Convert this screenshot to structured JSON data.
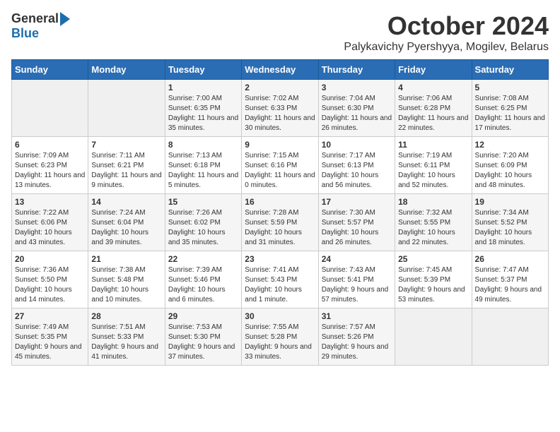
{
  "logo": {
    "general": "General",
    "blue": "Blue"
  },
  "title": {
    "month": "October 2024",
    "location": "Palykavichy Pyershyya, Mogilev, Belarus"
  },
  "headers": [
    "Sunday",
    "Monday",
    "Tuesday",
    "Wednesday",
    "Thursday",
    "Friday",
    "Saturday"
  ],
  "weeks": [
    [
      {
        "day": "",
        "sunrise": "",
        "sunset": "",
        "daylight": ""
      },
      {
        "day": "",
        "sunrise": "",
        "sunset": "",
        "daylight": ""
      },
      {
        "day": "1",
        "sunrise": "Sunrise: 7:00 AM",
        "sunset": "Sunset: 6:35 PM",
        "daylight": "Daylight: 11 hours and 35 minutes."
      },
      {
        "day": "2",
        "sunrise": "Sunrise: 7:02 AM",
        "sunset": "Sunset: 6:33 PM",
        "daylight": "Daylight: 11 hours and 30 minutes."
      },
      {
        "day": "3",
        "sunrise": "Sunrise: 7:04 AM",
        "sunset": "Sunset: 6:30 PM",
        "daylight": "Daylight: 11 hours and 26 minutes."
      },
      {
        "day": "4",
        "sunrise": "Sunrise: 7:06 AM",
        "sunset": "Sunset: 6:28 PM",
        "daylight": "Daylight: 11 hours and 22 minutes."
      },
      {
        "day": "5",
        "sunrise": "Sunrise: 7:08 AM",
        "sunset": "Sunset: 6:25 PM",
        "daylight": "Daylight: 11 hours and 17 minutes."
      }
    ],
    [
      {
        "day": "6",
        "sunrise": "Sunrise: 7:09 AM",
        "sunset": "Sunset: 6:23 PM",
        "daylight": "Daylight: 11 hours and 13 minutes."
      },
      {
        "day": "7",
        "sunrise": "Sunrise: 7:11 AM",
        "sunset": "Sunset: 6:21 PM",
        "daylight": "Daylight: 11 hours and 9 minutes."
      },
      {
        "day": "8",
        "sunrise": "Sunrise: 7:13 AM",
        "sunset": "Sunset: 6:18 PM",
        "daylight": "Daylight: 11 hours and 5 minutes."
      },
      {
        "day": "9",
        "sunrise": "Sunrise: 7:15 AM",
        "sunset": "Sunset: 6:16 PM",
        "daylight": "Daylight: 11 hours and 0 minutes."
      },
      {
        "day": "10",
        "sunrise": "Sunrise: 7:17 AM",
        "sunset": "Sunset: 6:13 PM",
        "daylight": "Daylight: 10 hours and 56 minutes."
      },
      {
        "day": "11",
        "sunrise": "Sunrise: 7:19 AM",
        "sunset": "Sunset: 6:11 PM",
        "daylight": "Daylight: 10 hours and 52 minutes."
      },
      {
        "day": "12",
        "sunrise": "Sunrise: 7:20 AM",
        "sunset": "Sunset: 6:09 PM",
        "daylight": "Daylight: 10 hours and 48 minutes."
      }
    ],
    [
      {
        "day": "13",
        "sunrise": "Sunrise: 7:22 AM",
        "sunset": "Sunset: 6:06 PM",
        "daylight": "Daylight: 10 hours and 43 minutes."
      },
      {
        "day": "14",
        "sunrise": "Sunrise: 7:24 AM",
        "sunset": "Sunset: 6:04 PM",
        "daylight": "Daylight: 10 hours and 39 minutes."
      },
      {
        "day": "15",
        "sunrise": "Sunrise: 7:26 AM",
        "sunset": "Sunset: 6:02 PM",
        "daylight": "Daylight: 10 hours and 35 minutes."
      },
      {
        "day": "16",
        "sunrise": "Sunrise: 7:28 AM",
        "sunset": "Sunset: 5:59 PM",
        "daylight": "Daylight: 10 hours and 31 minutes."
      },
      {
        "day": "17",
        "sunrise": "Sunrise: 7:30 AM",
        "sunset": "Sunset: 5:57 PM",
        "daylight": "Daylight: 10 hours and 26 minutes."
      },
      {
        "day": "18",
        "sunrise": "Sunrise: 7:32 AM",
        "sunset": "Sunset: 5:55 PM",
        "daylight": "Daylight: 10 hours and 22 minutes."
      },
      {
        "day": "19",
        "sunrise": "Sunrise: 7:34 AM",
        "sunset": "Sunset: 5:52 PM",
        "daylight": "Daylight: 10 hours and 18 minutes."
      }
    ],
    [
      {
        "day": "20",
        "sunrise": "Sunrise: 7:36 AM",
        "sunset": "Sunset: 5:50 PM",
        "daylight": "Daylight: 10 hours and 14 minutes."
      },
      {
        "day": "21",
        "sunrise": "Sunrise: 7:38 AM",
        "sunset": "Sunset: 5:48 PM",
        "daylight": "Daylight: 10 hours and 10 minutes."
      },
      {
        "day": "22",
        "sunrise": "Sunrise: 7:39 AM",
        "sunset": "Sunset: 5:46 PM",
        "daylight": "Daylight: 10 hours and 6 minutes."
      },
      {
        "day": "23",
        "sunrise": "Sunrise: 7:41 AM",
        "sunset": "Sunset: 5:43 PM",
        "daylight": "Daylight: 10 hours and 1 minute."
      },
      {
        "day": "24",
        "sunrise": "Sunrise: 7:43 AM",
        "sunset": "Sunset: 5:41 PM",
        "daylight": "Daylight: 9 hours and 57 minutes."
      },
      {
        "day": "25",
        "sunrise": "Sunrise: 7:45 AM",
        "sunset": "Sunset: 5:39 PM",
        "daylight": "Daylight: 9 hours and 53 minutes."
      },
      {
        "day": "26",
        "sunrise": "Sunrise: 7:47 AM",
        "sunset": "Sunset: 5:37 PM",
        "daylight": "Daylight: 9 hours and 49 minutes."
      }
    ],
    [
      {
        "day": "27",
        "sunrise": "Sunrise: 7:49 AM",
        "sunset": "Sunset: 5:35 PM",
        "daylight": "Daylight: 9 hours and 45 minutes."
      },
      {
        "day": "28",
        "sunrise": "Sunrise: 7:51 AM",
        "sunset": "Sunset: 5:33 PM",
        "daylight": "Daylight: 9 hours and 41 minutes."
      },
      {
        "day": "29",
        "sunrise": "Sunrise: 7:53 AM",
        "sunset": "Sunset: 5:30 PM",
        "daylight": "Daylight: 9 hours and 37 minutes."
      },
      {
        "day": "30",
        "sunrise": "Sunrise: 7:55 AM",
        "sunset": "Sunset: 5:28 PM",
        "daylight": "Daylight: 9 hours and 33 minutes."
      },
      {
        "day": "31",
        "sunrise": "Sunrise: 7:57 AM",
        "sunset": "Sunset: 5:26 PM",
        "daylight": "Daylight: 9 hours and 29 minutes."
      },
      {
        "day": "",
        "sunrise": "",
        "sunset": "",
        "daylight": ""
      },
      {
        "day": "",
        "sunrise": "",
        "sunset": "",
        "daylight": ""
      }
    ]
  ]
}
